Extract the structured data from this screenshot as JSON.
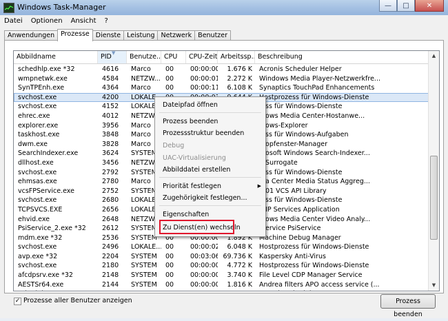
{
  "window": {
    "title": "Windows Task-Manager"
  },
  "menubar": [
    "Datei",
    "Optionen",
    "Ansicht",
    "?"
  ],
  "tabs": [
    "Anwendungen",
    "Prozesse",
    "Dienste",
    "Leistung",
    "Netzwerk",
    "Benutzer"
  ],
  "columns": [
    "Abbildname",
    "PID",
    "Benutze...",
    "CPU",
    "CPU-Zeit",
    "Arbeitssp...",
    "Beschreibung"
  ],
  "rows": [
    [
      "schedhlp.exe *32",
      "4616",
      "Marco",
      "00",
      "00:00:00",
      "1.676 K",
      "Acronis Scheduler Helper"
    ],
    [
      "wmpnetwk.exe",
      "4584",
      "NETZW...",
      "00",
      "00:00:01",
      "2.272 K",
      "Windows Media Player-Netzwerkfre..."
    ],
    [
      "SynTPEnh.exe",
      "4364",
      "Marco",
      "00",
      "00:00:11",
      "6.108 K",
      "Synaptics TouchPad Enhancements"
    ],
    [
      "svchost.exe",
      "4200",
      "LOKALE...",
      "00",
      "00:00:03",
      "9.644 K",
      "Hostprozess für Windows-Dienste"
    ],
    [
      "svchost.exe",
      "4152",
      "LOKALE",
      "",
      "",
      "",
      "...ss für Windows-Dienste"
    ],
    [
      "ehrec.exe",
      "4012",
      "NETZW",
      "",
      "",
      "",
      "...ows Media Center-Hostanwe..."
    ],
    [
      "explorer.exe",
      "3956",
      "Marco",
      "",
      "",
      "",
      "...ows-Explorer"
    ],
    [
      "taskhost.exe",
      "3848",
      "Marco",
      "",
      "",
      "",
      "...ss für Windows-Aufgaben"
    ],
    [
      "dwm.exe",
      "3828",
      "Marco",
      "",
      "",
      "",
      "...opfenster-Manager"
    ],
    [
      "SearchIndexer.exe",
      "3624",
      "SYSTEM",
      "",
      "",
      "",
      "...osoft Windows Search-Indexer..."
    ],
    [
      "dllhost.exe",
      "3456",
      "NETZW",
      "",
      "",
      "",
      "...Surrogate"
    ],
    [
      "svchost.exe",
      "2792",
      "SYSTEM",
      "",
      "",
      "",
      "...ss für Windows-Dienste"
    ],
    [
      "ehmsas.exe",
      "2780",
      "Marco",
      "",
      "",
      "",
      "...a Center Media Status Aggreg..."
    ],
    [
      "vcsFPService.exe",
      "2752",
      "SYSTEM",
      "",
      "",
      "",
      "...01 VCS API Library"
    ],
    [
      "svchost.exe",
      "2680",
      "LOKALE",
      "",
      "",
      "",
      "...ss für Windows-Dienste"
    ],
    [
      "TCPSVCS.EXE",
      "2656",
      "LOKALE",
      "",
      "",
      "",
      "...IP Services Application"
    ],
    [
      "ehvid.exe",
      "2648",
      "NETZW",
      "",
      "",
      "",
      "...ows Media Center Video Analy..."
    ],
    [
      "PsiService_2.exe *32",
      "2612",
      "SYSTEM",
      "",
      "",
      "",
      "...ervice PsiService"
    ],
    [
      "mdm.exe *32",
      "2536",
      "SYSTEM",
      "00",
      "00:00:00",
      "1.892 K",
      "Machine Debug Manager"
    ],
    [
      "svchost.exe",
      "2496",
      "LOKALE...",
      "00",
      "00:00:02",
      "6.048 K",
      "Hostprozess für Windows-Dienste"
    ],
    [
      "avp.exe *32",
      "2204",
      "SYSTEM",
      "00",
      "00:03:06",
      "69.736 K",
      "Kaspersky Anti-Virus"
    ],
    [
      "svchost.exe",
      "2180",
      "SYSTEM",
      "00",
      "00:00:00",
      "4.772 K",
      "Hostprozess für Windows-Dienste"
    ],
    [
      "afcdpsrv.exe *32",
      "2148",
      "SYSTEM",
      "00",
      "00:00:00",
      "3.740 K",
      "File Level CDP Manager Service"
    ],
    [
      "AESTSr64.exe",
      "2144",
      "SYSTEM",
      "00",
      "00:00:00",
      "1.816 K",
      "Andrea filters APO access service (..."
    ],
    [
      "schedul2.exe",
      "2060",
      "SYSTEM",
      "00",
      "00:00:00",
      "1.836 K",
      "Acronis Scheduler 2"
    ]
  ],
  "context_menu": {
    "items": [
      {
        "label": "Dateipfad öffnen"
      },
      {
        "label": "Prozess beenden"
      },
      {
        "label": "Prozessstruktur beenden"
      },
      {
        "label": "Debug",
        "disabled": true
      },
      {
        "label": "UAC-Virtualisierung",
        "disabled": true
      },
      {
        "label": "Abbilddatei erstellen"
      },
      {
        "label": "Priorität festlegen",
        "submenu": true
      },
      {
        "label": "Zugehörigkeit festlegen..."
      },
      {
        "label": "Eigenschaften"
      },
      {
        "label": "Zu Dienst(en) wechseln"
      }
    ]
  },
  "footer": {
    "checkbox_label": "Prozesse aller Benutzer anzeigen",
    "checkbox_checked": true,
    "end_button": "Prozess beenden"
  },
  "colors": {
    "highlight": "#e0162c",
    "selection": "#dbe8f7"
  }
}
